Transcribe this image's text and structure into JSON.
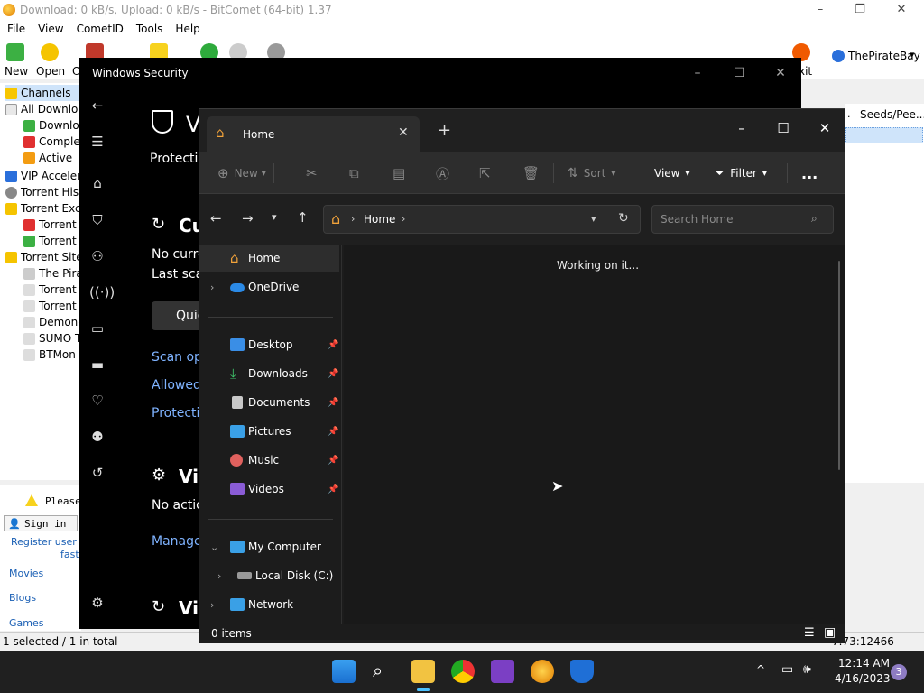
{
  "bitcomet": {
    "title": "Download: 0 kB/s, Upload: 0 kB/s - BitComet (64-bit) 1.37",
    "menu": [
      "File",
      "View",
      "CometID",
      "Tools",
      "Help"
    ],
    "toolbar": {
      "new": "New",
      "open": "Open",
      "open_partial": "O",
      "exit_partial": "xit",
      "piratebay": "ThePirateBay"
    },
    "tree": [
      "Channels",
      "All Downloa",
      "Downlo",
      "Comple",
      "Active",
      "VIP Accelera",
      "Torrent Hist",
      "Torrent Excl",
      "Torrent",
      "Torrent",
      "Torrent Sites",
      "The Pira",
      "Torrent",
      "Torrent",
      "Demonc",
      "SUMO T",
      "BTMon"
    ],
    "column_header": "Seeds/Pee...",
    "bottom": {
      "please": "Please",
      "sign_in": "Sign in",
      "register": "Register user c",
      "faster": "faste",
      "movies": "Movies",
      "blogs": "Blogs",
      "games": "Games"
    },
    "status": "1 selected / 1 in total",
    "status_right": "7.73:12466",
    "colors": {
      "accent": "#1a5fb4"
    }
  },
  "winsec": {
    "title": "Windows Security",
    "heading_partial": "V",
    "protection": "Protectio",
    "current_threats": "Cu",
    "no_current": "No curre",
    "last_scan": "Last sca",
    "quick_button": "Quic",
    "scan_options": "Scan opt",
    "allowed": "Allowed",
    "protection_history": "Protectio",
    "virus_settings": "Vi",
    "no_action": "No actio",
    "manage": "Manage",
    "virus_updates": "Vi"
  },
  "explorer": {
    "tab_title": "Home",
    "new_tab": "+",
    "commands": {
      "new": "New",
      "sort": "Sort",
      "view": "View",
      "filter": "Filter",
      "more": "..."
    },
    "breadcrumb": "Home",
    "search_placeholder": "Search Home",
    "sidebar": {
      "home": "Home",
      "onedrive": "OneDrive",
      "desktop": "Desktop",
      "downloads": "Downloads",
      "documents": "Documents",
      "pictures": "Pictures",
      "music": "Music",
      "videos": "Videos",
      "my_computer": "My Computer",
      "local_disk": "Local Disk (C:)",
      "network": "Network"
    },
    "content_message": "Working on it...",
    "status_items": "0 items"
  },
  "taskbar": {
    "time": "12:14 AM",
    "date": "4/16/2023",
    "badge": "3"
  }
}
